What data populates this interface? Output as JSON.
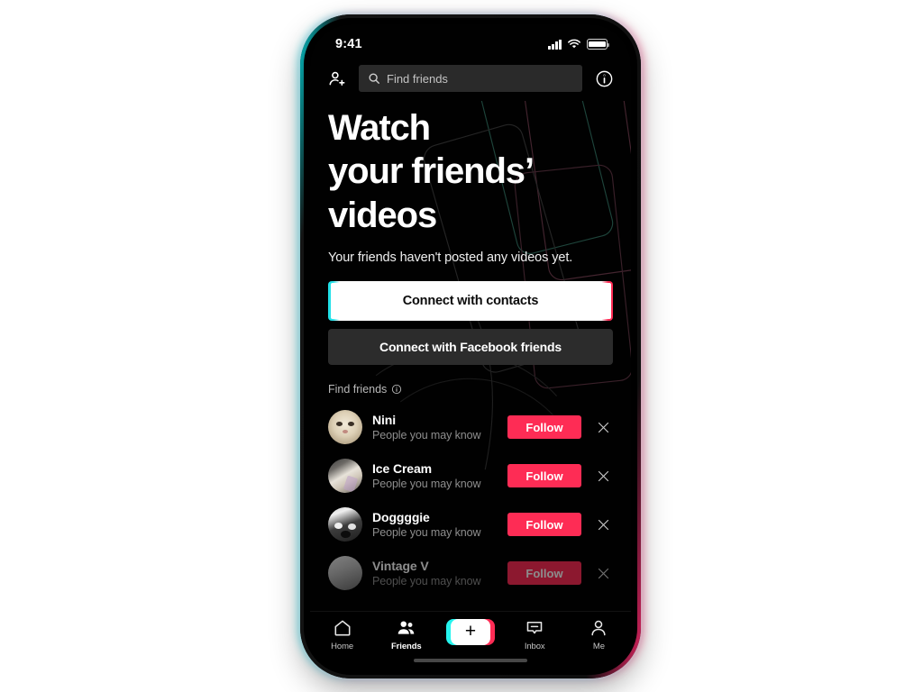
{
  "status_bar": {
    "time": "9:41",
    "cellular_icon": "signal-bars-icon",
    "wifi_icon": "wifi-icon",
    "battery_icon": "battery-icon"
  },
  "header": {
    "add_friend_icon": "person-add-icon",
    "search_icon": "search-icon",
    "search_placeholder": "Find friends",
    "search_value": "",
    "info_icon": "info-circle-icon"
  },
  "hero": {
    "title_line1": "Watch",
    "title_line2": "your friends’",
    "title_line3": "videos",
    "subtitle": "Your friends haven't posted any videos yet."
  },
  "actions": {
    "primary_label": "Connect with contacts",
    "secondary_label": "Connect with Facebook friends"
  },
  "find_friends": {
    "section_label": "Find friends",
    "section_info_icon": "info-circle-icon",
    "follow_label": "Follow",
    "dismiss_icon": "close-icon",
    "suggestions": [
      {
        "name": "Nini",
        "subtitle": "People you may know",
        "avatar": "cat-avatar"
      },
      {
        "name": "Ice Cream",
        "subtitle": "People you may know",
        "avatar": "ice-cream-avatar"
      },
      {
        "name": "Doggggie",
        "subtitle": "People you may know",
        "avatar": "dog-avatar"
      },
      {
        "name": "Vintage V",
        "subtitle": "People you may know",
        "avatar": "partial-avatar"
      }
    ]
  },
  "tab_bar": {
    "tabs": [
      {
        "label": "Home",
        "icon": "home-icon",
        "active": false
      },
      {
        "label": "Friends",
        "icon": "friends-icon",
        "active": true
      },
      {
        "label": "Inbox",
        "icon": "inbox-icon",
        "active": false
      },
      {
        "label": "Me",
        "icon": "person-icon",
        "active": false
      }
    ],
    "create_icon": "plus-icon"
  },
  "colors": {
    "accent_pink": "#FE2C55",
    "accent_cyan": "#25F4EE",
    "screen_bg": "#010101",
    "page_bg": "#FFFFFF"
  }
}
